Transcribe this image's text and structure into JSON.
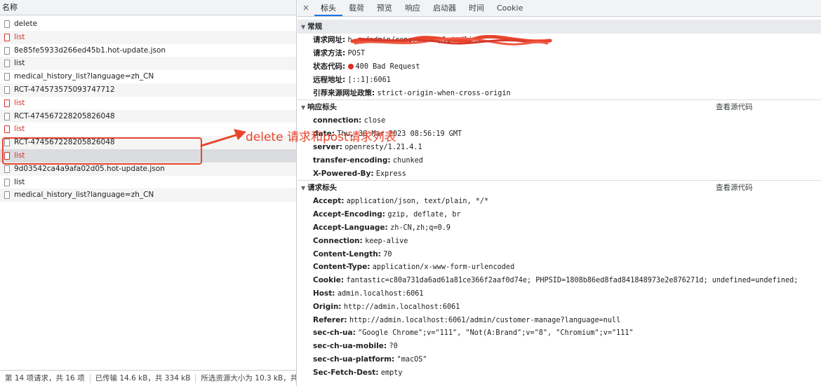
{
  "list": {
    "header": "名称",
    "rows": [
      {
        "name": "delete",
        "error": false
      },
      {
        "name": "list",
        "error": true
      },
      {
        "name": "8e85fe5933d266ed45b1.hot-update.json",
        "error": false
      },
      {
        "name": "list",
        "error": false
      },
      {
        "name": "medical_history_list?language=zh_CN",
        "error": false
      },
      {
        "name": "RCT-474573575093747712",
        "error": false
      },
      {
        "name": "list",
        "error": true
      },
      {
        "name": "RCT-474567228205826048",
        "error": false
      },
      {
        "name": "list",
        "error": true
      },
      {
        "name": "RCT-474567228205826048",
        "error": false
      },
      {
        "name": "list",
        "error": true
      },
      {
        "name": "9d03542ca4a9afa02d05.hot-update.json",
        "error": false
      },
      {
        "name": "list",
        "error": false
      },
      {
        "name": "medical_history_list?language=zh_CN",
        "error": false
      }
    ]
  },
  "status": {
    "requests": "第 14 项请求，共 16 项",
    "transferred": "已传输 14.6 kB，共 334 kB",
    "resources": "所选资源大小为 10.3 kB，共"
  },
  "tabs": {
    "close": "×",
    "items": [
      "标头",
      "载荷",
      "预览",
      "响应",
      "启动器",
      "时间",
      "Cookie"
    ]
  },
  "general": {
    "title": "常规",
    "rows": [
      {
        "k": "请求网址:",
        "v": "h… …/admin/report/template/list"
      },
      {
        "k": "请求方法:",
        "v": "POST"
      },
      {
        "k": "状态代码:",
        "v": "400 Bad Request"
      },
      {
        "k": "远程地址:",
        "v": "[::1]:6061"
      },
      {
        "k": "引荐来源网址政策:",
        "v": "strict-origin-when-cross-origin"
      }
    ]
  },
  "response_headers": {
    "title": "响应标头",
    "view_source": "查看源代码",
    "rows": [
      {
        "k": "connection:",
        "v": "close"
      },
      {
        "k": "date:",
        "v": "Thu, 30 Mar 2023 08:56:19 GMT"
      },
      {
        "k": "server:",
        "v": "openresty/1.21.4.1"
      },
      {
        "k": "transfer-encoding:",
        "v": "chunked"
      },
      {
        "k": "X-Powered-By:",
        "v": "Express"
      }
    ]
  },
  "request_headers": {
    "title": "请求标头",
    "view_source": "查看源代码",
    "rows": [
      {
        "k": "Accept:",
        "v": "application/json, text/plain, */*"
      },
      {
        "k": "Accept-Encoding:",
        "v": "gzip, deflate, br"
      },
      {
        "k": "Accept-Language:",
        "v": "zh-CN,zh;q=0.9"
      },
      {
        "k": "Connection:",
        "v": "keep-alive"
      },
      {
        "k": "Content-Length:",
        "v": "70"
      },
      {
        "k": "Content-Type:",
        "v": "application/x-www-form-urlencoded"
      },
      {
        "k": "Cookie:",
        "v": "fantastic=c80a731da6ad61a81ce366f2aaf0d74e; PHPSID=1808b86ed8fad841848973e2e876271d; undefined=undefined;"
      },
      {
        "k": "Host:",
        "v": "admin.localhost:6061"
      },
      {
        "k": "Origin:",
        "v": "http://admin.localhost:6061"
      },
      {
        "k": "Referer:",
        "v": "http://admin.localhost:6061/admin/customer-manage?language=null"
      },
      {
        "k": "sec-ch-ua:",
        "v": "\"Google Chrome\";v=\"111\", \"Not(A:Brand\";v=\"8\", \"Chromium\";v=\"111\""
      },
      {
        "k": "sec-ch-ua-mobile:",
        "v": "?0"
      },
      {
        "k": "sec-ch-ua-platform:",
        "v": "\"macOS\""
      },
      {
        "k": "Sec-Fetch-Dest:",
        "v": "empty"
      }
    ]
  },
  "annotation": {
    "text": "delete 请求和post请求列表",
    "color": "#e8452c"
  }
}
